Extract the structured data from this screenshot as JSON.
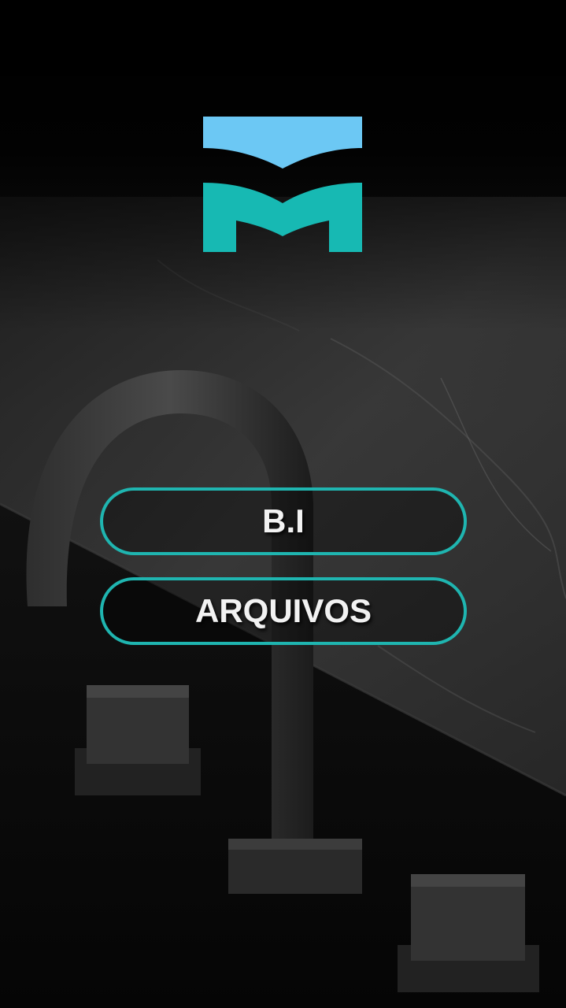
{
  "app": {
    "logo_name": "brand-m-wave-logo",
    "colors": {
      "logo_top": "#6cc8f4",
      "logo_bottom": "#17b9b3",
      "button_border": "#1fb5b0",
      "button_text": "#f2f2f2",
      "background": "#000000"
    }
  },
  "menu": {
    "items": [
      {
        "label": "B.I"
      },
      {
        "label": "ARQUIVOS"
      }
    ]
  },
  "background_image": {
    "icon": "matte-black-faucet-marble-photo"
  }
}
